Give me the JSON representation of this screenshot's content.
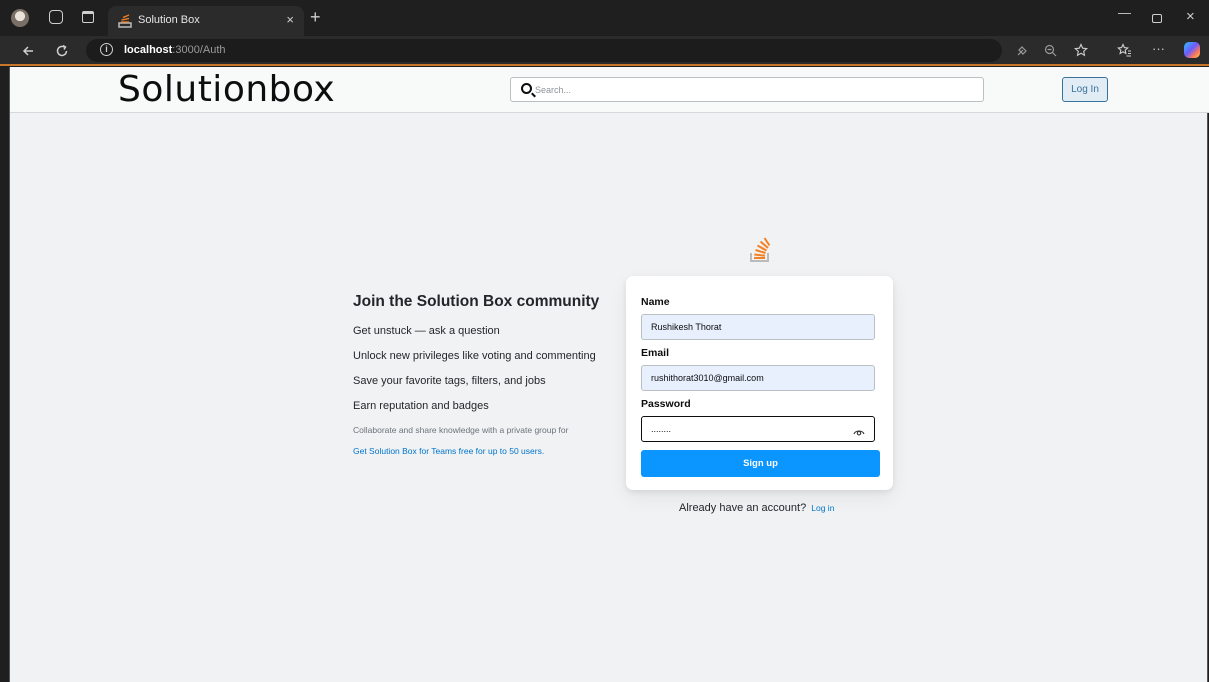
{
  "browser": {
    "tab_title": "Solution Box",
    "tab_close": "×",
    "new_tab": "+",
    "url_host": "localhost",
    "url_path": ":3000/Auth"
  },
  "header": {
    "logo": "Solutionbox",
    "search_placeholder": "Search...",
    "login_label": "Log In"
  },
  "pitch": {
    "title": "Join the Solution Box community",
    "items": [
      "Get unstuck — ask a question",
      "Unlock new privileges like voting and commenting",
      "Save your favorite tags, filters, and jobs",
      "Earn reputation and badges"
    ],
    "note": "Collaborate and share knowledge with a private group for",
    "teams_link": "Get Solution Box for Teams free for up to 50 users."
  },
  "form": {
    "name_label": "Name",
    "name_value": "Rushikesh Thorat",
    "email_label": "Email",
    "email_value": "rushithorat3010@gmail.com",
    "password_label": "Password",
    "password_value": "........",
    "signup_label": "Sign up"
  },
  "footer": {
    "already_text": "Already have an account?",
    "login_link": "Log in"
  },
  "colors": {
    "accent": "#0a95ff",
    "link": "#0074cc",
    "header_bg": "#f8f9f9",
    "page_bg": "#f1f2f3",
    "brand_orange": "#f48024"
  }
}
